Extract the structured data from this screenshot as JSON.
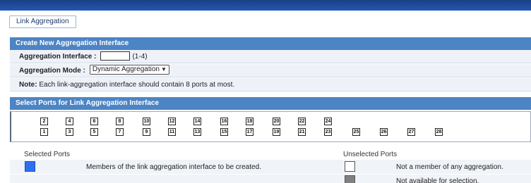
{
  "tab": {
    "label": "Link Aggregation"
  },
  "create_section": {
    "title": "Create New Aggregation Interface",
    "interface_label": "Aggregation Interface :",
    "interface_value": "",
    "interface_range": "(1-4)",
    "mode_label": "Aggregation Mode :",
    "mode_value": "Dynamic Aggregation",
    "note_label": "Note:",
    "note_text": "Each link-aggregation interface should contain 8 ports at most."
  },
  "select_section": {
    "title": "Select Ports for Link Aggregation Interface",
    "top_row_ports": [
      "2",
      "4",
      "6",
      "8",
      "10",
      "12",
      "14",
      "16",
      "18",
      "20",
      "22",
      "24"
    ],
    "bottom_row_ports": [
      "1",
      "3",
      "5",
      "7",
      "9",
      "11",
      "13",
      "15",
      "17",
      "19",
      "21",
      "23",
      "25",
      "26",
      "27",
      "28"
    ]
  },
  "legend": {
    "selected_title": "Selected Ports",
    "unselected_title": "Unselected Ports",
    "members_text": "Members of the link aggregation interface to be created.",
    "not_member_text": "Not a member of any aggregation.",
    "not_available_text": "Not available for selection.",
    "colors": {
      "selected": "#2f6ff0",
      "unselected": "#ffffff",
      "unavailable": "#808080"
    }
  }
}
